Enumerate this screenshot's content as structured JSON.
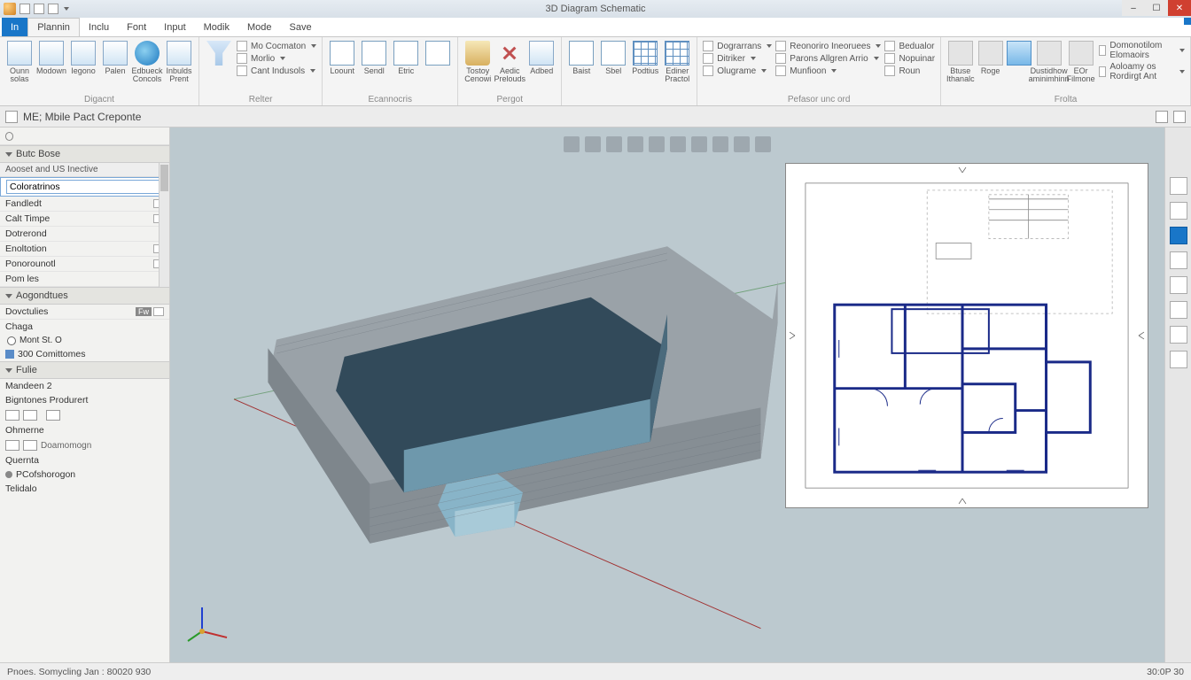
{
  "titlebar": {
    "title": "3D Diagram Schematic"
  },
  "window_controls": {
    "min": "–",
    "max": "☐",
    "close": "✕"
  },
  "menu": {
    "file": "In",
    "tabs": [
      "Plannin",
      "Inclu",
      "Font",
      "Input",
      "Modik",
      "Mode",
      "Save"
    ]
  },
  "ribbon": {
    "groups": [
      {
        "label": "Digacnt",
        "big": [
          {
            "name": "cube-icon",
            "label": "Ounn solas"
          },
          {
            "name": "window-icon",
            "label": "Modown"
          },
          {
            "name": "layers-icon",
            "label": "Iegono"
          },
          {
            "name": "filter-icon",
            "label": "Palen"
          },
          {
            "name": "globe-icon",
            "label": "Edbueck Concols"
          },
          {
            "name": "target-icon",
            "label": "Inbulds Prent"
          }
        ]
      },
      {
        "label": "Relter",
        "big": [
          {
            "name": "funnel-icon",
            "label": ""
          }
        ],
        "rows": [
          {
            "icon": "check",
            "label": "Mo Cocmaton",
            "dd": true
          },
          {
            "icon": "check",
            "label": "Morlio",
            "dd": true
          },
          {
            "icon": "check",
            "label": "Cant Indusols",
            "dd": true
          }
        ]
      },
      {
        "label": "Ecannocris",
        "big": [
          {
            "name": "page-icon",
            "label": "Loount"
          },
          {
            "name": "page2-icon",
            "label": "Sendl"
          },
          {
            "name": "page3-icon",
            "label": "Etric"
          },
          {
            "name": "page4-icon",
            "label": ""
          }
        ]
      },
      {
        "label": "Pergot",
        "big": [
          {
            "name": "clipboard-icon",
            "label": "Tostoy Cenowi"
          },
          {
            "name": "x-icon",
            "label": "Aedic Prelouds"
          },
          {
            "name": "arrow-icon",
            "label": "Adbed"
          }
        ]
      },
      {
        "label": "",
        "big": [
          {
            "name": "rect-icon",
            "label": "Baist"
          },
          {
            "name": "rect2-icon",
            "label": "Sbel"
          },
          {
            "name": "table-icon",
            "label": "Podtius"
          },
          {
            "name": "table2-icon",
            "label": "Ediner Practol"
          }
        ]
      },
      {
        "label": "Pefasor unc ord",
        "rows": [
          {
            "icon": "tag",
            "label": "Dograrrans",
            "dd": true
          },
          {
            "icon": "tag",
            "label": "Ditriker",
            "dd": true
          },
          {
            "icon": "tag",
            "label": "Olugrame",
            "dd": true
          }
        ],
        "rows2": [
          {
            "icon": "box",
            "label": "Reonoriro Ineoruees",
            "dd": true
          },
          {
            "icon": "box",
            "label": "Parons Allgren Arrio",
            "dd": true
          },
          {
            "icon": "box",
            "label": "Munfioon",
            "dd": true
          }
        ],
        "rows3": [
          {
            "icon": "box",
            "label": "Bedualor"
          },
          {
            "icon": "box",
            "label": "Nopuinar"
          },
          {
            "icon": "box",
            "label": "Roun"
          }
        ]
      },
      {
        "label": "Frolta",
        "big": [
          {
            "name": "gray1-icon",
            "label": "Btuse Ithanalc"
          },
          {
            "name": "gray2-icon",
            "label": "Roge"
          },
          {
            "name": "accent-icon",
            "label": ""
          },
          {
            "name": "gray3-icon",
            "label": "Dustidhow aminimhinn"
          },
          {
            "name": "gray4-icon",
            "label": "EOr Filmone"
          }
        ],
        "rows": [
          {
            "icon": "gear",
            "label": "Domonotilom Elomaoirs",
            "dd": true
          },
          {
            "icon": "gear",
            "label": "Aoloamy os Rordirgt  Ant",
            "dd": true
          }
        ]
      }
    ]
  },
  "viewheader": {
    "title": "ME; Mbile Pact Creponte"
  },
  "left": {
    "search_placeholder": "",
    "sec1": {
      "header": "Butc Bose",
      "sub": "Aooset and US Inective",
      "input_value": "Coloratrinos",
      "rows": [
        {
          "label": "Fandledt",
          "ic": true
        },
        {
          "label": "Calt Timpe",
          "ic": true
        },
        {
          "label": "Dotrerond",
          "ic": false
        },
        {
          "label": "Enoltotion",
          "ic": true
        },
        {
          "label": "Ponorounotl",
          "ic": true
        },
        {
          "label": "Pom les",
          "ic": true
        }
      ]
    },
    "sec2": {
      "header": "Aogondtues",
      "row_a": "Dovctulies",
      "row_a_btn": "Fw",
      "row_b": "Chaga",
      "radio": "Mont St. O",
      "row_c": "300 Comittomes"
    },
    "sec3": {
      "header": "Fulie",
      "rows": [
        "Mandeen  2",
        "Bigntones Produrert"
      ],
      "row_c": "Ohmerne",
      "row_d": "Doamomogn",
      "row_e": "Quernta",
      "row_f": "PCofshorogon",
      "row_g": "Telidalo"
    }
  },
  "viewport_tools": [
    "info",
    "clock",
    "gear",
    "cube",
    "home",
    "light",
    "grid",
    "cam1",
    "cam2",
    "misc"
  ],
  "rightrail": [
    "tool-a",
    "tool-b",
    "tool-c",
    "tool-d",
    "tool-e",
    "tool-f",
    "tool-g",
    "tool-h"
  ],
  "status": {
    "left": "Pnoes. Somycling Jan : 80020 930",
    "right": "30:0P 30"
  }
}
